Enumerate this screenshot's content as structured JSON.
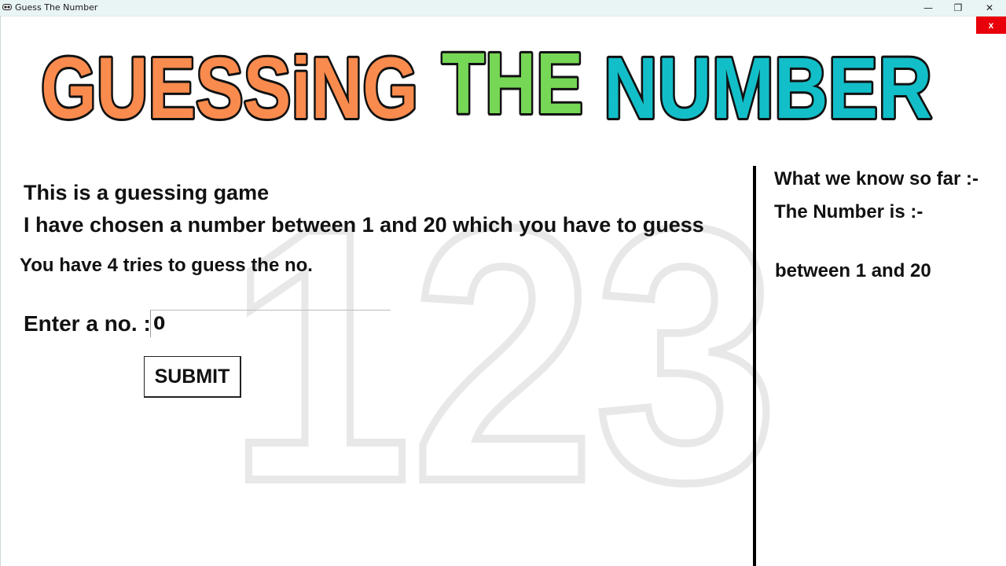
{
  "window": {
    "title": "Guess The Number",
    "minimize_glyph": "—",
    "maximize_glyph": "❐",
    "close_glyph": "✕"
  },
  "app_close_button": "x",
  "banner": {
    "words": [
      {
        "text": "GUESSiNG",
        "color": "#f98b4e"
      },
      {
        "text": "THE",
        "color": "#76d655"
      },
      {
        "text": "NUMBER",
        "color": "#12bfc9"
      }
    ]
  },
  "watermark": {
    "text": "123"
  },
  "game": {
    "intro": "This is a guessing game",
    "description": "I have chosen a number between 1 and 20 which you have to guess",
    "tries": "You have 4 tries to guess the no.",
    "enter_label": "Enter a no. :",
    "input_value": "0",
    "submit_label": "SUBMIT"
  },
  "info": {
    "title": "What we know so far :-",
    "number_is": "The Number is :-",
    "range": "between 1 and 20"
  }
}
